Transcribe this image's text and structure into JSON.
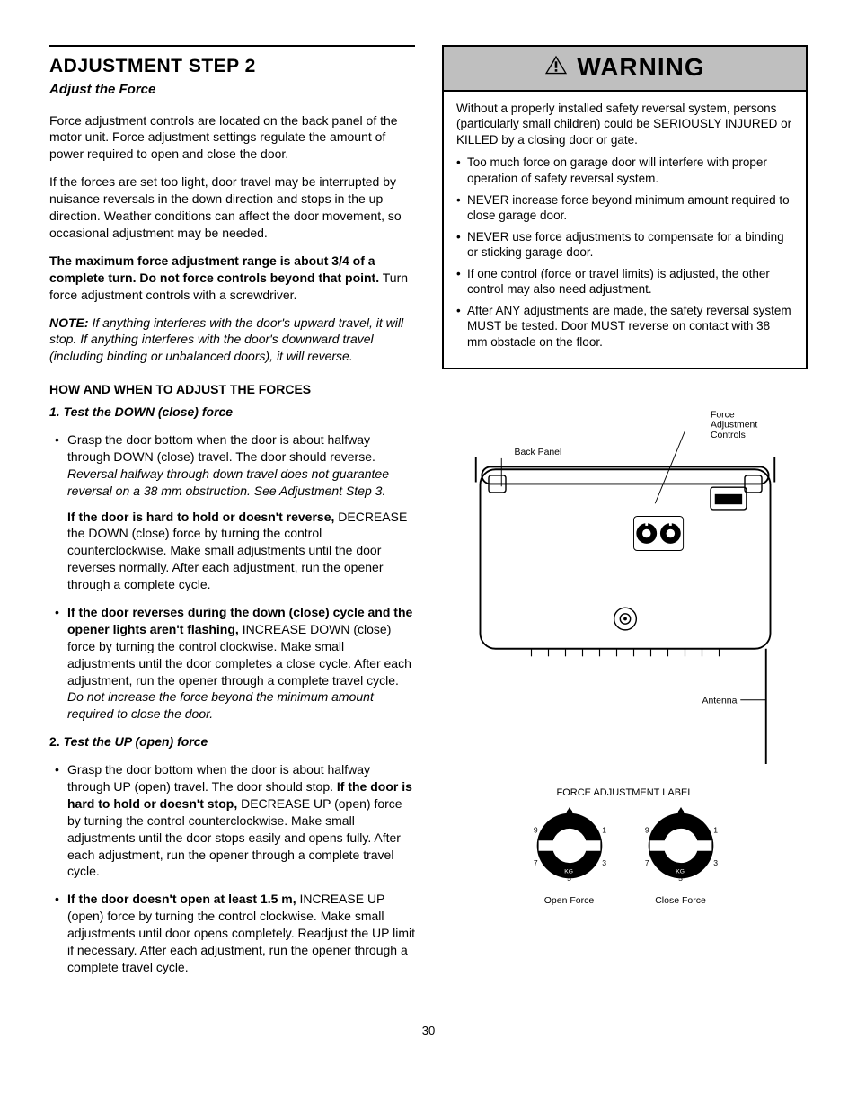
{
  "left": {
    "title": "ADJUSTMENT STEP 2",
    "subtitle": "Adjust the Force",
    "p1": "Force adjustment controls are located on the back panel of the motor unit. Force adjustment settings regulate the amount of power required to open and close the door.",
    "p2": "If the forces are set too light, door travel may be interrupted by nuisance reversals in the down direction and stops in the up direction. Weather conditions can affect the door movement, so occasional adjustment may be needed.",
    "p3_bold": "The maximum force adjustment range is about 3/4 of a complete turn. Do not force controls beyond that point.",
    "p3_rest": " Turn force adjustment controls with a screwdriver.",
    "note_label": "NOTE:",
    "note": " If anything interferes with the door's upward travel, it will stop. If anything interferes with the door's downward travel (including binding or unbalanced doors), it will reverse.",
    "howwhen": "HOW AND WHEN TO ADJUST THE FORCES",
    "step1_num": "1.",
    "step1_label": "Test the DOWN (close) force",
    "step1_b1a": "Grasp the door bottom when the door is about halfway through DOWN (close) travel. The door should reverse. ",
    "step1_b1b_ital": "Reversal halfway through down travel does not guarantee reversal on a 38 mm obstruction. See Adjustment Step 3.",
    "step1_b1_sub_bold": "If the door is hard to hold or doesn't reverse,",
    "step1_b1_sub_rest": " DECREASE the DOWN (close) force by turning the control counterclockwise. Make small adjustments until the door reverses normally. After each adjustment, run the opener through a complete cycle.",
    "step1_b2_bold": "If the door reverses during the down (close) cycle and the opener lights aren't flashing,",
    "step1_b2_rest": " INCREASE DOWN (close) force by turning the control clockwise. Make small adjustments until the door completes a close cycle. After each adjustment, run the opener through a complete travel cycle. ",
    "step1_b2_ital": "Do not increase the force beyond the minimum amount required to close the door.",
    "step2_num": "2.",
    "step2_label": "Test the UP (open) force",
    "step2_b1a": "Grasp the door bottom when the door is about halfway through UP (open) travel. The door should stop. ",
    "step2_b1_bold": "If the door is hard to hold or doesn't stop,",
    "step2_b1_rest": " DECREASE UP (open) force by turning the control counterclockwise. Make small adjustments until the door stops easily and opens fully. After each adjustment, run the opener through a complete travel cycle.",
    "step2_b2_bold": "If the door doesn't open at least 1.5 m,",
    "step2_b2_rest": " INCREASE UP (open) force by turning the control clockwise. Make small adjustments until door opens completely. Readjust the UP limit if necessary. After each adjustment, run the opener through a complete travel cycle."
  },
  "warning": {
    "heading": "WARNING",
    "intro": "Without a properly installed safety reversal system, persons (particularly small children) could be SERIOUSLY INJURED or KILLED by a closing door or gate.",
    "bullets": [
      "Too much force on garage door will interfere with proper operation of safety reversal system.",
      "NEVER increase force beyond minimum amount required to close garage door.",
      "NEVER use force adjustments to compensate for a binding or sticking garage door.",
      "If one control (force or travel limits) is adjusted, the other control may also need adjustment.",
      "After ANY adjustments are made, the safety reversal system MUST be tested. Door MUST reverse on contact with 38 mm obstacle on the floor."
    ]
  },
  "diagram": {
    "force_controls": "Force\nAdjustment\nControls",
    "back_panel": "Back Panel",
    "antenna": "Antenna",
    "label_heading": "FORCE ADJUSTMENT LABEL",
    "open_force": "Open Force",
    "close_force": "Close Force",
    "dial": {
      "n1": "1",
      "n3": "3",
      "n5": "5",
      "n7": "7",
      "n9": "9",
      "kg": "KG"
    }
  },
  "page": "30"
}
